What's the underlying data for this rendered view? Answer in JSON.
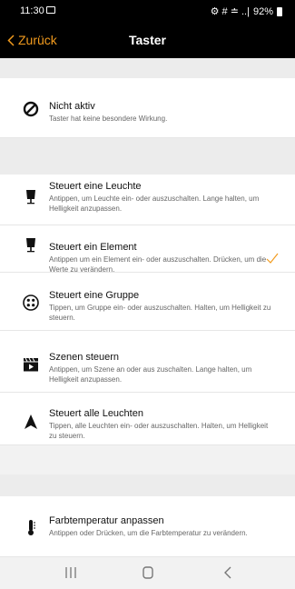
{
  "status": {
    "time": "11:30",
    "signal": "⚙ # ≐ ..|",
    "battery": "92%"
  },
  "nav": {
    "back_label": "Zurück",
    "title": "Taster"
  },
  "inactive": {
    "label": "Nicht aktiv",
    "description": "Taster hat keine besondere Wirkung."
  },
  "options": [
    {
      "label": "Steuert eine Leuchte",
      "description": "Antippen, um Leuchte ein- oder auszuschalten. Lange halten, um Helligkeit anzupassen.",
      "icon": "lamp-icon"
    },
    {
      "label": "Steuert ein Element",
      "description": "Antippen um ein Element ein- oder auszuschalten. Drücken, um die Werte zu verändern.",
      "icon": "lamp-icon",
      "selected": true
    },
    {
      "label": "Steuert eine Gruppe",
      "description": "Tippen, um Gruppe ein- oder auszuschalten. Halten, um Helligkeit zu steuern.",
      "icon": "group-icon"
    },
    {
      "label": "Szenen steuern",
      "description": "Antippen, um Szene an oder aus zuschalten. Lange halten, um Helligkeit anzupassen.",
      "icon": "scene-icon"
    },
    {
      "label": "Steuert alle Leuchten",
      "description": "Tippen, alle Leuchten ein- oder auszuschalten. Halten, um Helligkeit zu steuern.",
      "icon": "all-lights-icon"
    }
  ],
  "extra": {
    "label": "Farbtemperatur anpassen",
    "description": "Antippen oder Drücken, um die Farbtemperatur zu verändern.",
    "icon": "thermometer-icon"
  },
  "colors": {
    "accent": "#f29b1e",
    "header": "#000000"
  }
}
